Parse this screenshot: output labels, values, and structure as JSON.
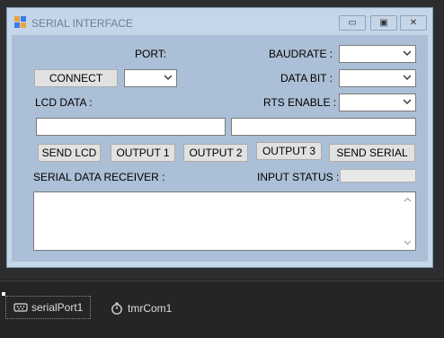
{
  "window": {
    "title": "SERIAL INTERFACE",
    "minimize_glyph": "▭",
    "maximize_glyph": "▣",
    "close_glyph": "✕"
  },
  "labels": {
    "port": "PORT:",
    "baudrate": "BAUDRATE  :",
    "data_bit": "DATA BIT  :",
    "lcd_data": "LCD DATA :",
    "rts_enable": "RTS ENABLE :",
    "serial_data_receiver": "SERIAL DATA RECEIVER :",
    "input_status": "INPUT STATUS :"
  },
  "buttons": {
    "connect": "CONNECT",
    "send_lcd": "SEND LCD",
    "output1": "OUTPUT 1",
    "output2": "OUTPUT 2",
    "output3": "OUTPUT 3",
    "send_serial": "SEND SERIAL"
  },
  "inputs": {
    "port_value": "",
    "baudrate_value": "",
    "data_bit_value": "",
    "rts_enable_value": "",
    "lcd_text": "",
    "serial_text": "",
    "receiver_text": ""
  },
  "tray": {
    "component1": "serialPort1",
    "component2": "tmrCom1"
  },
  "icons": {
    "app": "app-icon",
    "dropdown": "chevron-down-icon",
    "serial_port": "serial-port-icon",
    "timer": "timer-icon",
    "scroll_up": "scroll-up-icon",
    "scroll_down": "scroll-down-icon"
  }
}
